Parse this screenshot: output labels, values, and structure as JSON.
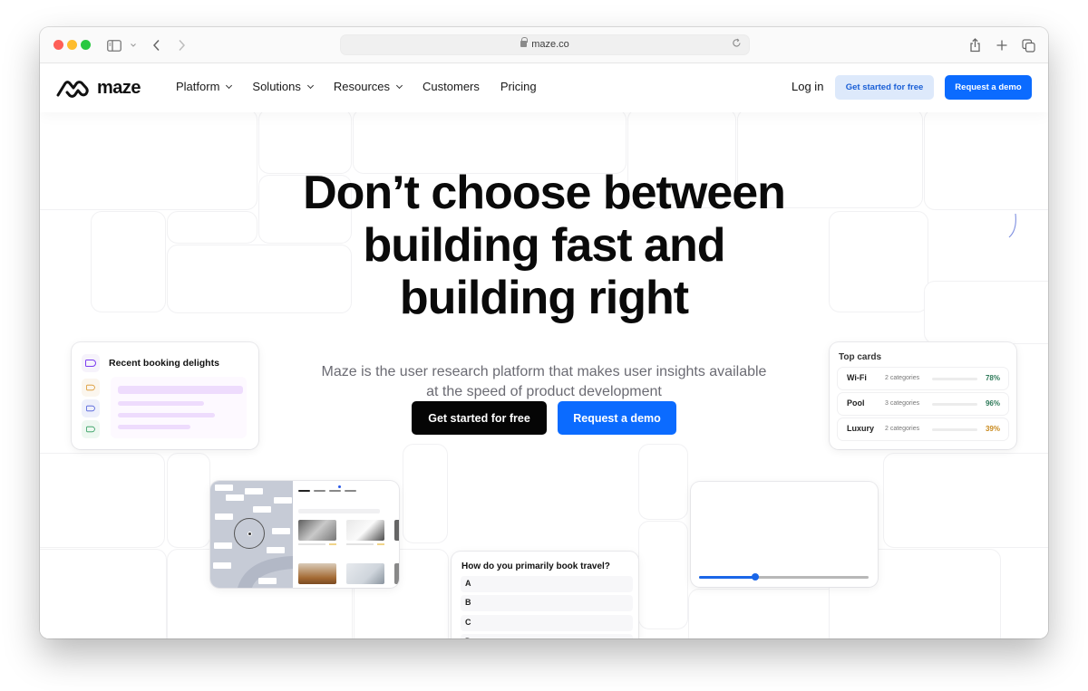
{
  "browser": {
    "url": "maze.co",
    "icons": [
      "sidebar-icon",
      "chevron-down-icon",
      "back-icon",
      "forward-icon",
      "lock-icon",
      "reload-icon",
      "share-icon",
      "new-tab-icon",
      "tabs-overview-icon"
    ]
  },
  "nav": {
    "logo_text": "maze",
    "links": [
      {
        "label": "Platform",
        "dropdown": true
      },
      {
        "label": "Solutions",
        "dropdown": true
      },
      {
        "label": "Resources",
        "dropdown": true
      },
      {
        "label": "Customers",
        "dropdown": false
      },
      {
        "label": "Pricing",
        "dropdown": false
      }
    ],
    "login": "Log in",
    "get_started": "Get started for free",
    "request_demo": "Request a demo"
  },
  "hero": {
    "title_lines": [
      "Don’t choose between",
      "building fast and",
      "building right"
    ],
    "subtitle_lines": [
      "Maze is the user research platform that makes user insights available",
      "at the speed of product development"
    ],
    "cta_primary": "Get started for free",
    "cta_secondary": "Request a demo"
  },
  "cards": {
    "booking": {
      "title": "Recent booking delights",
      "tag_colors": [
        "#7a3cf0",
        "#d9942a",
        "#4a5ad8",
        "#2a9a5a"
      ]
    },
    "top_cards": {
      "title": "Top cards",
      "rows": [
        {
          "name": "Wi-Fi",
          "categories": "2 categories",
          "percent": "78%",
          "value": 0.78,
          "color": "#2f7a5a"
        },
        {
          "name": "Pool",
          "categories": "3 categories",
          "percent": "96%",
          "value": 0.96,
          "color": "#2f7a5a"
        },
        {
          "name": "Luxury",
          "categories": "2 categories",
          "percent": "39%",
          "value": 0.39,
          "color": "#c98a1e"
        }
      ]
    },
    "question": {
      "title": "How do you primarily book travel?",
      "options": [
        "A",
        "B",
        "C",
        "D"
      ]
    },
    "slider": {
      "value": 0.33
    }
  },
  "colors": {
    "brand_blue": "#0b6bff",
    "light_blue_bg": "#dde9fb",
    "dark_button": "#050505"
  }
}
